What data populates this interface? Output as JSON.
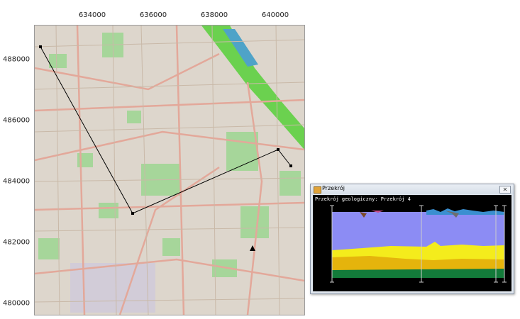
{
  "map": {
    "x_ticks": [
      "634000",
      "636000",
      "638000",
      "640000"
    ],
    "y_ticks": [
      "488000",
      "486000",
      "484000",
      "482000",
      "480000"
    ]
  },
  "section_window": {
    "title": "Przekrój",
    "close_label": "✕",
    "label": "Przekrój geologiczny: Przekrój 4"
  },
  "colors": {
    "map_base": "#ddd6cc",
    "road": "#e3a89a",
    "park": "#9ed391",
    "river": "#6bd14f",
    "section_line": "#000000",
    "layer_upper": "#8c8cf4",
    "layer_yellow": "#f4ec1c",
    "layer_ochre": "#e5b40c",
    "layer_green": "#137b3a",
    "section_bg": "#000000"
  },
  "icons": [
    "app-window-icon",
    "close-icon"
  ]
}
